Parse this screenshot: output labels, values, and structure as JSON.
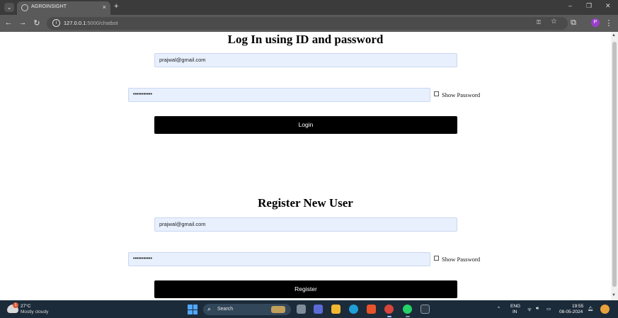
{
  "browser": {
    "tab_title": "AGROINSIGHT",
    "tab_close": "×",
    "new_tab": "+",
    "menu_glyph": "⌄",
    "nav": {
      "back": "←",
      "forward": "→",
      "reload": "↻"
    },
    "url_host": "127.0.0.1",
    "url_path": ":5000/chatbot",
    "password_key_glyph": "⚿",
    "star_glyph": "☆",
    "extensions_glyph": "⧉",
    "profile_initial": "P",
    "more_glyph": "⋮",
    "window": {
      "minimize": "–",
      "restore": "❐",
      "close": "✕"
    }
  },
  "login": {
    "title": "Log In using ID and password",
    "email_value": "prajwal@gmail.com",
    "password_mask": "•••••••••••",
    "show_password_label": "Show Password",
    "button_label": "Login"
  },
  "register": {
    "title": "Register New User",
    "email_value": "prajwal@gmail.com",
    "password_mask": "•••••••••••",
    "show_password_label": "Show Password",
    "button_label": "Register"
  },
  "taskbar": {
    "weather_badge": "1",
    "weather_temp": "27°C",
    "weather_desc": "Mostly cloudy",
    "search_label": "Search",
    "search_glyph": "⌕",
    "chevron": "^",
    "lang_top": "ENG",
    "lang_bottom": "IN",
    "wifi_glyph": "ᯤ",
    "volume_glyph": "🔊︎",
    "battery_glyph": "▭",
    "time": "19:55",
    "date": "08-05-2024",
    "bell_glyph": "🔔︎"
  },
  "colors": {
    "field_bg": "#e8f0fe",
    "button_bg": "#000000",
    "taskbar_bg": "#1c2b3a",
    "chrome_bg": "#3b3b3b"
  }
}
